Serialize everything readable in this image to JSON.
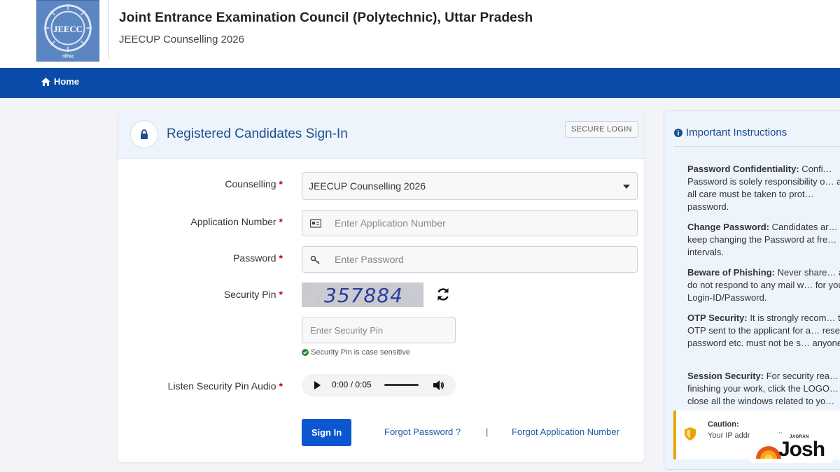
{
  "header": {
    "logo_text": "JEECC",
    "logo_subtext": "परिषद",
    "title": "Joint Entrance Examination Council (Polytechnic), Uttar Pradesh",
    "subtitle": "JEECUP Counselling 2026"
  },
  "navbar": {
    "home_label": "Home"
  },
  "login": {
    "title": "Registered Candidates Sign-In",
    "badge": "SECURE LOGIN",
    "fields": {
      "counselling": {
        "label": "Counselling",
        "value": "JEECUP Counselling 2026"
      },
      "application_number": {
        "label": "Application Number",
        "placeholder": "Enter Application Number"
      },
      "password": {
        "label": "Password",
        "placeholder": "Enter Password"
      },
      "security_pin": {
        "label": "Security Pin",
        "captcha": "357884",
        "placeholder": "Enter Security Pin",
        "hint": "Security Pin is case sensitive"
      },
      "audio": {
        "label": "Listen Security Pin Audio",
        "time": "0:00 / 0:05"
      }
    },
    "required_marker": "*",
    "signin_label": "Sign In",
    "forgot_password": "Forgot Password ?",
    "separator": "|",
    "forgot_application": "Forgot Application Number"
  },
  "instructions": {
    "title": "Important Instructions",
    "items": [
      {
        "title": "Password Confidentiality:",
        "text": "Confi… Password is solely responsibility o… and all care must be taken to prot… password."
      },
      {
        "title": "Change Password:",
        "text": "Candidates ar… keep changing the Password at fre… intervals."
      },
      {
        "title": "Beware of Phishing:",
        "text": "Never share… and do not respond to any mail w… for your Login-ID/Password."
      },
      {
        "title": "OTP Security:",
        "text": "It is strongly recom… the OTP sent to the applicant for a… reset password etc. must not be s… anyone."
      },
      {
        "title": "Session Security:",
        "text": "For security rea… finishing your work, click the LOGO… close all the windows related to yo…"
      }
    ],
    "caution": {
      "title": "Caution:",
      "text": "Your IP addr… security pur…"
    }
  },
  "watermark": {
    "top": "JAGRAN",
    "brand": "Josh"
  },
  "colors": {
    "navbar": "#0a4aa8",
    "accent": "#1a4f8f",
    "signin": "#0b57d0",
    "required": "#cc0000",
    "caution": "#e8a700"
  }
}
